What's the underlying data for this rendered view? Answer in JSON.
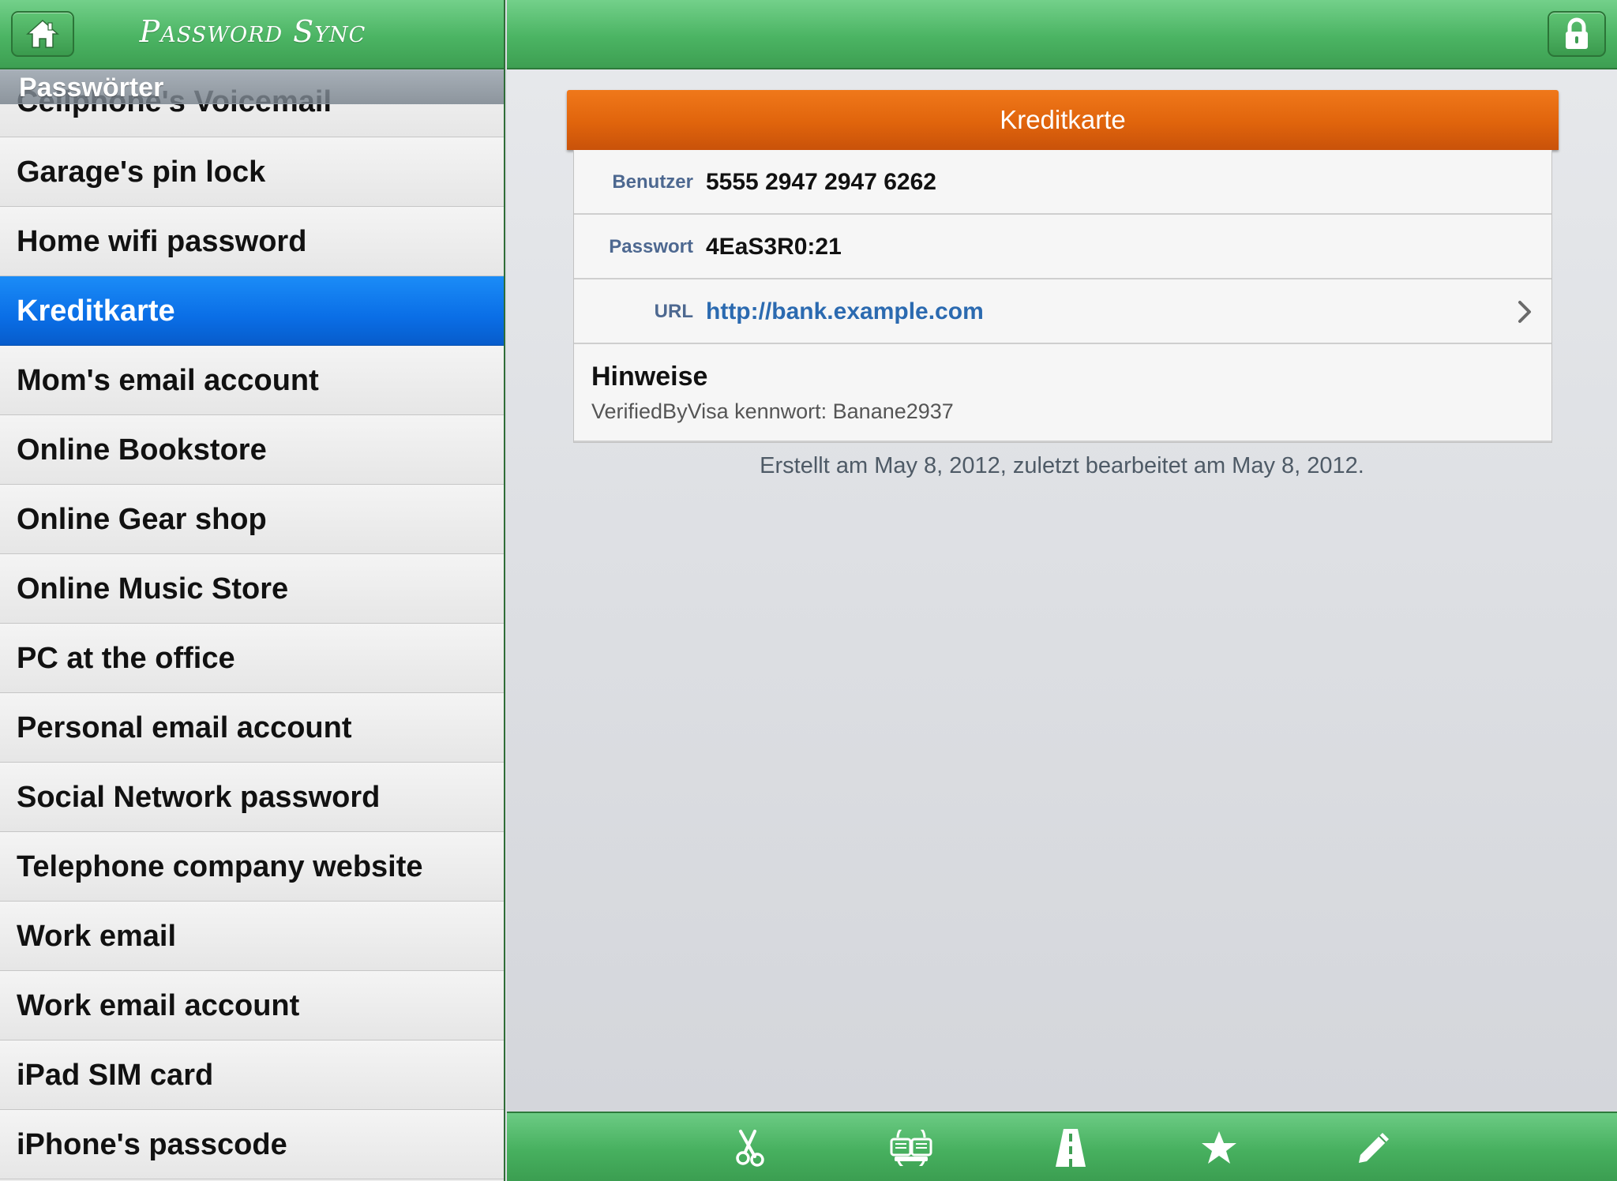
{
  "left": {
    "app_title": "Password Sync",
    "section_header": "Passwörter",
    "items": [
      {
        "label": "Cellphone's Voicemail"
      },
      {
        "label": "Garage's pin lock"
      },
      {
        "label": "Home wifi password"
      },
      {
        "label": "Kreditkarte"
      },
      {
        "label": "Mom's email account"
      },
      {
        "label": "Online Bookstore"
      },
      {
        "label": "Online Gear shop"
      },
      {
        "label": "Online Music Store"
      },
      {
        "label": "PC at the office"
      },
      {
        "label": "Personal email account"
      },
      {
        "label": "Social Network password"
      },
      {
        "label": "Telephone company website"
      },
      {
        "label": "Work email"
      },
      {
        "label": "Work email account"
      },
      {
        "label": "iPad SIM card"
      },
      {
        "label": "iPhone's passcode"
      }
    ],
    "selected_index": 3
  },
  "detail": {
    "title": "Kreditkarte",
    "fields": {
      "user_label": "Benutzer",
      "user_value": "5555 2947 2947 6262",
      "password_label": "Passwort",
      "password_value": "4EaS3R0:21",
      "url_label": "URL",
      "url_value": "http://bank.example.com"
    },
    "notes_title": "Hinweise",
    "notes_text": "VerifiedByVisa kennwort: Banane2937",
    "timestamp": "Erstellt am May 8, 2012, zuletzt bearbeitet am May 8, 2012."
  },
  "toolbar": {
    "buttons": [
      "scissors-icon",
      "sync-icon",
      "road-icon",
      "star-icon",
      "pencil-icon"
    ]
  },
  "colors": {
    "nav_green": "#4bb463",
    "selection_blue": "#0a6ee6",
    "header_orange": "#e0640c",
    "field_label": "#4d6890",
    "link": "#2b6ab0"
  }
}
